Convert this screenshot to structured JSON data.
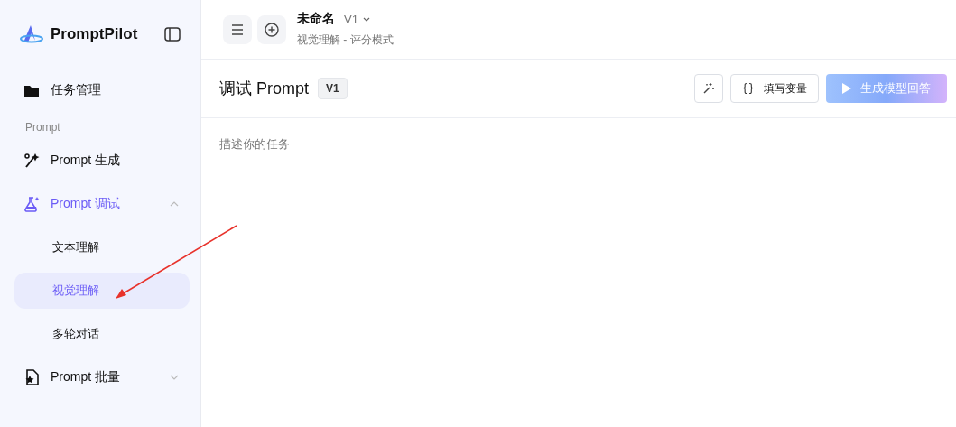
{
  "brand": "PromptPilot",
  "sidebar": {
    "items": [
      {
        "kind": "item",
        "label": "任务管理",
        "selected": false
      },
      {
        "kind": "section",
        "label": "Prompt"
      },
      {
        "kind": "item",
        "label": "Prompt 生成",
        "selected": false
      },
      {
        "kind": "group",
        "label": "Prompt 调试",
        "expanded": true,
        "active": true,
        "children": [
          {
            "label": "文本理解",
            "selected": false
          },
          {
            "label": "视觉理解",
            "selected": true
          },
          {
            "label": "多轮对话",
            "selected": false
          }
        ]
      },
      {
        "kind": "group",
        "label": "Prompt 批量",
        "expanded": false,
        "active": false
      }
    ]
  },
  "header": {
    "title": "未命名",
    "version": "V1",
    "subtitle": "视觉理解 - 评分模式"
  },
  "panel": {
    "title": "调试 Prompt",
    "version": "V1",
    "variables_icon": "{}",
    "variables_button": "填写变量",
    "generate_button": "生成模型回答",
    "generate_disabled": true,
    "placeholder": "描述你的任务"
  }
}
